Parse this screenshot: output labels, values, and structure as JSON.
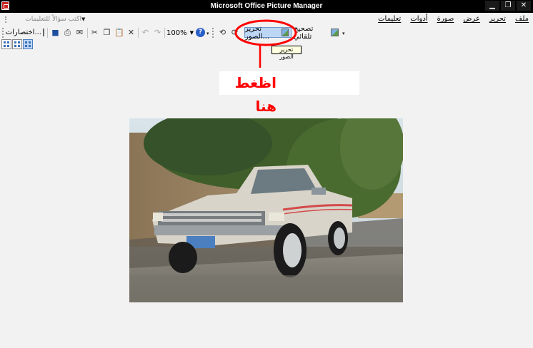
{
  "window": {
    "title": "Microsoft Office Picture Manager",
    "minimize_symbol": "▁",
    "maximize_symbol": "❐",
    "close_symbol": "✕"
  },
  "menu": {
    "items": [
      "ملف",
      "تحرير",
      "عرض",
      "صورة",
      "أدوات",
      "تعليمات"
    ]
  },
  "help_search": {
    "placeholder": "اكتب سؤالاً للتعليمات"
  },
  "toolbar": {
    "shortcuts_label": "اختصارات...",
    "zoom_value": "100%",
    "edit_pictures_label": "تحرير الصور...",
    "auto_correct_label": "تصحيح تلقائي",
    "help_symbol": "?"
  },
  "tooltip": {
    "text": "تحرير الصور"
  },
  "annotation": {
    "text": "اظغط هنا",
    "color": "#ff0000"
  },
  "icons": {
    "app": "picture-manager-icon",
    "save": "save-icon",
    "print": "print-icon",
    "email": "email-icon",
    "cut": "cut-icon",
    "copy": "copy-icon",
    "paste": "paste-icon",
    "delete": "delete-icon",
    "undo": "undo-icon",
    "redo": "redo-icon",
    "rotate_left": "rotate-left-icon",
    "rotate_right": "rotate-right-icon"
  },
  "colors": {
    "title_bar": "#000000",
    "workspace": "#f2f2f2",
    "selected_button": "#bcd6f4"
  }
}
